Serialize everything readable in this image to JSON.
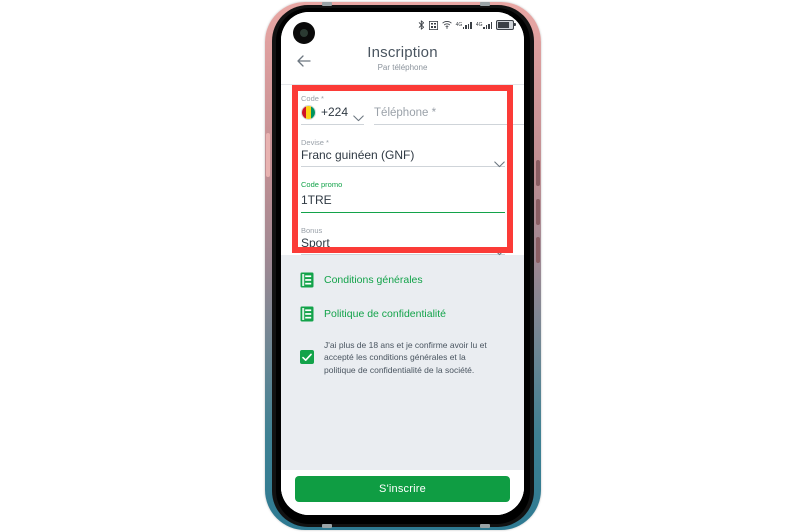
{
  "statusbar": {
    "bluetooth_icon": "bluetooth-icon",
    "nfc_icon": "nfc-icon",
    "wifi_icon": "wifi-icon",
    "sim1_label": "4G",
    "sim2_label": "4G",
    "battery_label": "92"
  },
  "header": {
    "back_icon": "back-arrow-icon",
    "title": "Inscription",
    "subtitle": "Par téléphone"
  },
  "form": {
    "code": {
      "label": "Code *",
      "flag_icon": "guinea-flag-icon",
      "value": "+224",
      "chevron_icon": "chevron-down-icon"
    },
    "phone": {
      "placeholder": "Téléphone *",
      "value": ""
    },
    "currency": {
      "label": "Devise *",
      "value": "Franc guinéen (GNF)",
      "chevron_icon": "chevron-down-icon"
    },
    "promo": {
      "label": "Code promo",
      "value": "1TRE"
    },
    "bonus": {
      "label": "Bonus",
      "value": "Sport",
      "chevron_icon": "chevron-down-icon"
    }
  },
  "links": [
    {
      "icon": "document-icon",
      "label": "Conditions générales"
    },
    {
      "icon": "document-icon",
      "label": "Politique de confidentialité"
    }
  ],
  "consent": {
    "checked": true,
    "check_icon": "checkmark-icon",
    "text": "J'ai plus de 18 ans et je confirme avoir lu et accepté les conditions générales et la politique de confidentialité de la société."
  },
  "footer": {
    "submit_label": "S'inscrire"
  },
  "colors": {
    "accent_green": "#13a34a",
    "button_green": "#0f9d43",
    "highlight_red": "#fb3b37",
    "screen_bg": "#eaedf1",
    "text_dark": "#2f3943",
    "label_grey": "#9aa1a9"
  }
}
